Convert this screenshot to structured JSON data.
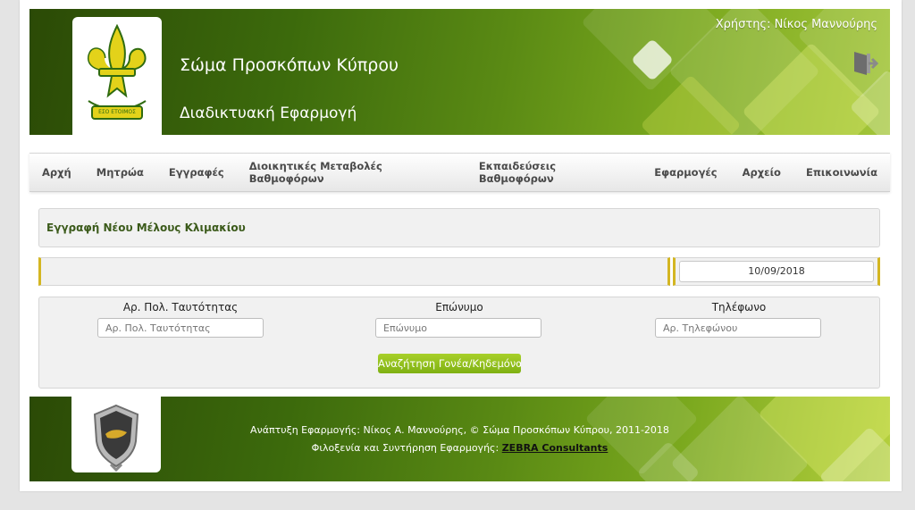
{
  "header": {
    "org_title": "Σώμα Προσκόπων Κύπρου",
    "app_title": "Διαδικτυακή Εφαρμογή",
    "user_label": "Χρήστης: Νίκος Μαννούρης",
    "logo_motto": "ΕΣΟ ΕΤΟΙΜΟΣ",
    "logout_icon": "logout-door-icon"
  },
  "nav": {
    "items": [
      {
        "label": "Αρχή"
      },
      {
        "label": "Μητρώα"
      },
      {
        "label": "Εγγραφές"
      },
      {
        "label": "Διοικητικές Μεταβολές Βαθμοφόρων"
      },
      {
        "label": "Εκπαιδεύσεις Βαθμοφόρων"
      },
      {
        "label": "Εφαρμογές"
      },
      {
        "label": "Αρχείο"
      },
      {
        "label": "Επικοινωνία"
      }
    ]
  },
  "page": {
    "title": "Εγγραφή Νέου Μέλους Κλιμακίου",
    "date": "10/09/2018"
  },
  "search": {
    "id_label": "Αρ. Πολ. Ταυτότητας",
    "id_placeholder": "Αρ. Πολ. Ταυτότητας",
    "surname_label": "Επώνυμο",
    "surname_placeholder": "Επώνυμο",
    "phone_label": "Τηλέφωνο",
    "phone_placeholder": "Αρ. Τηλεφώνου",
    "button_label": "Αναζήτηση Γονέα/Κηδεμόνα"
  },
  "footer": {
    "line1": "Ανάπτυξη Εφαρμογής: Νίκος Α. Μαννούρης, © Σώμα Προσκόπων Κύπρου, 2011-2018",
    "line2_prefix": "Φιλοξενία και Συντήρηση Εφαρμογής: ",
    "line2_link": "ZEBRA Consultants"
  },
  "colors": {
    "header_dark": "#2b4a06",
    "header_light": "#a4c63a",
    "accent_yellow": "#d4b622",
    "button_green": "#8fbf1a",
    "title_green": "#3b5a1a"
  }
}
